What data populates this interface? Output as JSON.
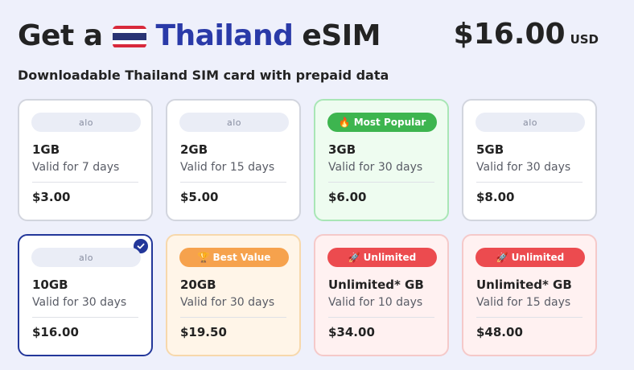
{
  "header": {
    "title_prefix": "Get a",
    "country": "Thailand",
    "title_suffix": "eSIM",
    "price": "$16.00",
    "currency": "USD",
    "subtitle": "Downloadable Thailand SIM card with prepaid data"
  },
  "colors": {
    "accent": "#23379a",
    "popular": "#3db54f",
    "best_value": "#f6a24d",
    "unlimited": "#ec4b4f"
  },
  "plans": [
    {
      "tag": "alo",
      "data": "1GB",
      "validity": "Valid for 7 days",
      "price": "$3.00"
    },
    {
      "tag": "alo",
      "data": "2GB",
      "validity": "Valid for 15 days",
      "price": "$5.00"
    },
    {
      "tag": "Most Popular",
      "data": "3GB",
      "validity": "Valid for 30 days",
      "price": "$6.00"
    },
    {
      "tag": "alo",
      "data": "5GB",
      "validity": "Valid for 30 days",
      "price": "$8.00"
    },
    {
      "tag": "alo",
      "data": "10GB",
      "validity": "Valid for 30 days",
      "price": "$16.00",
      "selected": true
    },
    {
      "tag": "Best Value",
      "data": "20GB",
      "validity": "Valid for 30 days",
      "price": "$19.50"
    },
    {
      "tag": "Unlimited",
      "data": "Unlimited* GB",
      "validity": "Valid for 10 days",
      "price": "$34.00"
    },
    {
      "tag": "Unlimited",
      "data": "Unlimited* GB",
      "validity": "Valid for 15 days",
      "price": "$48.00"
    }
  ]
}
